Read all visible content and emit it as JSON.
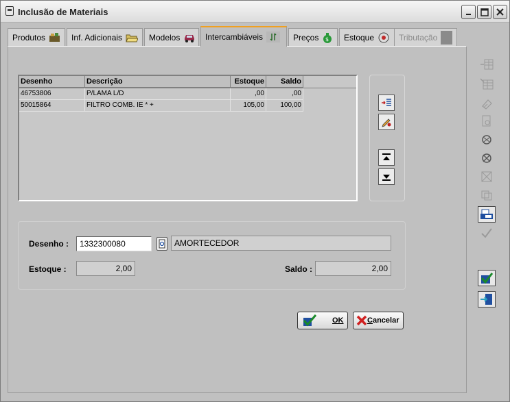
{
  "window": {
    "title": "Inclusão de Materiais"
  },
  "tabs": [
    {
      "label": "Produtos",
      "icon": "products-icon",
      "state": "normal"
    },
    {
      "label": "Inf. Adicionais",
      "icon": "folder-icon",
      "state": "normal"
    },
    {
      "label": "Modelos",
      "icon": "car-icon",
      "state": "normal"
    },
    {
      "label": "Intercambiáveis",
      "icon": "interchange-icon",
      "state": "active"
    },
    {
      "label": "Preços",
      "icon": "money-bag-icon",
      "state": "normal"
    },
    {
      "label": "Estoque",
      "icon": "stock-icon",
      "state": "normal"
    },
    {
      "label": "Tributação",
      "icon": "tax-icon",
      "state": "disabled"
    }
  ],
  "grid": {
    "columns": [
      "Desenho",
      "Descrição",
      "Estoque",
      "Saldo"
    ],
    "rows": [
      [
        "46753806",
        "P/LAMA L/D",
        ",00",
        ",00"
      ],
      [
        "50015864",
        "FILTRO COMB. IE * +",
        "105,00",
        "100,00"
      ]
    ]
  },
  "form": {
    "desenho_label": "Desenho :",
    "desenho_value": "1332300080",
    "descricao_value": "AMORTECEDOR",
    "estoque_label": "Estoque :",
    "estoque_value": "2,00",
    "saldo_label": "Saldo :",
    "saldo_value": "2,00"
  },
  "actions": {
    "ok_label": "OK",
    "cancel_label": "ancelar",
    "cancel_underline": "C"
  },
  "colors": {
    "window_bg": "#c0c0c0",
    "active_tab_accent": "#f0a020",
    "ok_check": "#1a8a2a",
    "cancel_x": "#d02020",
    "tool_blue": "#1f4fa0"
  }
}
